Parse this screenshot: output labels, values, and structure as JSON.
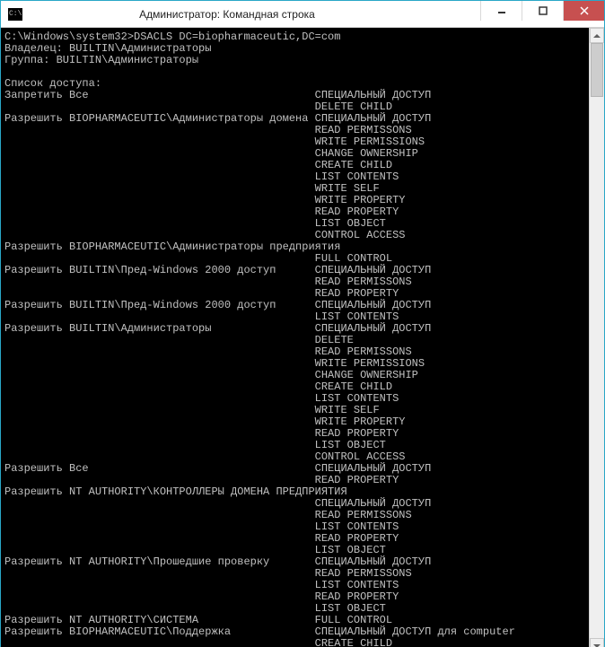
{
  "window": {
    "title": "Администратор: Командная строка"
  },
  "prompt": {
    "path": "C:\\Windows\\system32>",
    "command": "DSACLS DC=biopharmaceutic,DC=com"
  },
  "header": {
    "owner_label": "Владелец:",
    "owner_value": "BUILTIN\\Администраторы",
    "group_label": "Группа:",
    "group_value": "BUILTIN\\Администраторы"
  },
  "list_title": "Список доступа:",
  "entries": [
    {
      "action": "Запретить",
      "trustee": "Все",
      "perms": [
        "СПЕЦИАЛЬНЫЙ ДОСТУП",
        "DELETE CHILD"
      ]
    },
    {
      "action": "Разрешить",
      "trustee": "BIOPHARMACEUTIC\\Администраторы домена",
      "perms": [
        "СПЕЦИАЛЬНЫЙ ДОСТУП",
        "READ PERMISSONS",
        "WRITE PERMISSIONS",
        "CHANGE OWNERSHIP",
        "CREATE CHILD",
        "LIST CONTENTS",
        "WRITE SELF",
        "WRITE PROPERTY",
        "READ PROPERTY",
        "LIST OBJECT",
        "CONTROL ACCESS"
      ]
    },
    {
      "action": "Разрешить",
      "trustee": "BIOPHARMACEUTIC\\Администраторы предприятия",
      "perms": [
        "FULL CONTROL"
      ]
    },
    {
      "action": "Разрешить",
      "trustee": "BUILTIN\\Пред-Windows 2000 доступ",
      "perms": [
        "СПЕЦИАЛЬНЫЙ ДОСТУП",
        "READ PERMISSONS",
        "READ PROPERTY"
      ]
    },
    {
      "action": "Разрешить",
      "trustee": "BUILTIN\\Пред-Windows 2000 доступ",
      "perms": [
        "СПЕЦИАЛЬНЫЙ ДОСТУП",
        "LIST CONTENTS"
      ]
    },
    {
      "action": "Разрешить",
      "trustee": "BUILTIN\\Администраторы",
      "perms": [
        "СПЕЦИАЛЬНЫЙ ДОСТУП",
        "DELETE",
        "READ PERMISSONS",
        "WRITE PERMISSIONS",
        "CHANGE OWNERSHIP",
        "CREATE CHILD",
        "LIST CONTENTS",
        "WRITE SELF",
        "WRITE PROPERTY",
        "READ PROPERTY",
        "LIST OBJECT",
        "CONTROL ACCESS"
      ]
    },
    {
      "action": "Разрешить",
      "trustee": "Все",
      "perms": [
        "СПЕЦИАЛЬНЫЙ ДОСТУП",
        "READ PROPERTY"
      ]
    },
    {
      "action": "Разрешить",
      "trustee": "NT AUTHORITY\\КОНТРОЛЛЕРЫ ДОМЕНА ПРЕДПРИЯТИЯ",
      "perms": [
        "СПЕЦИАЛЬНЫЙ ДОСТУП",
        "READ PERMISSONS",
        "LIST CONTENTS",
        "READ PROPERTY",
        "LIST OBJECT"
      ]
    },
    {
      "action": "Разрешить",
      "trustee": "NT AUTHORITY\\Прошедшие проверку",
      "perms": [
        "СПЕЦИАЛЬНЫЙ ДОСТУП",
        "READ PERMISSONS",
        "LIST CONTENTS",
        "READ PROPERTY",
        "LIST OBJECT"
      ]
    },
    {
      "action": "Разрешить",
      "trustee": "NT AUTHORITY\\СИСТЕМА",
      "perms": [
        "FULL CONTROL"
      ]
    },
    {
      "action": "Разрешить",
      "trustee": "BIOPHARMACEUTIC\\Поддержка",
      "perms": [
        "СПЕЦИАЛЬНЫЙ ДОСТУП для computer",
        "CREATE CHILD"
      ]
    }
  ],
  "layout": {
    "perm_col": 48
  }
}
